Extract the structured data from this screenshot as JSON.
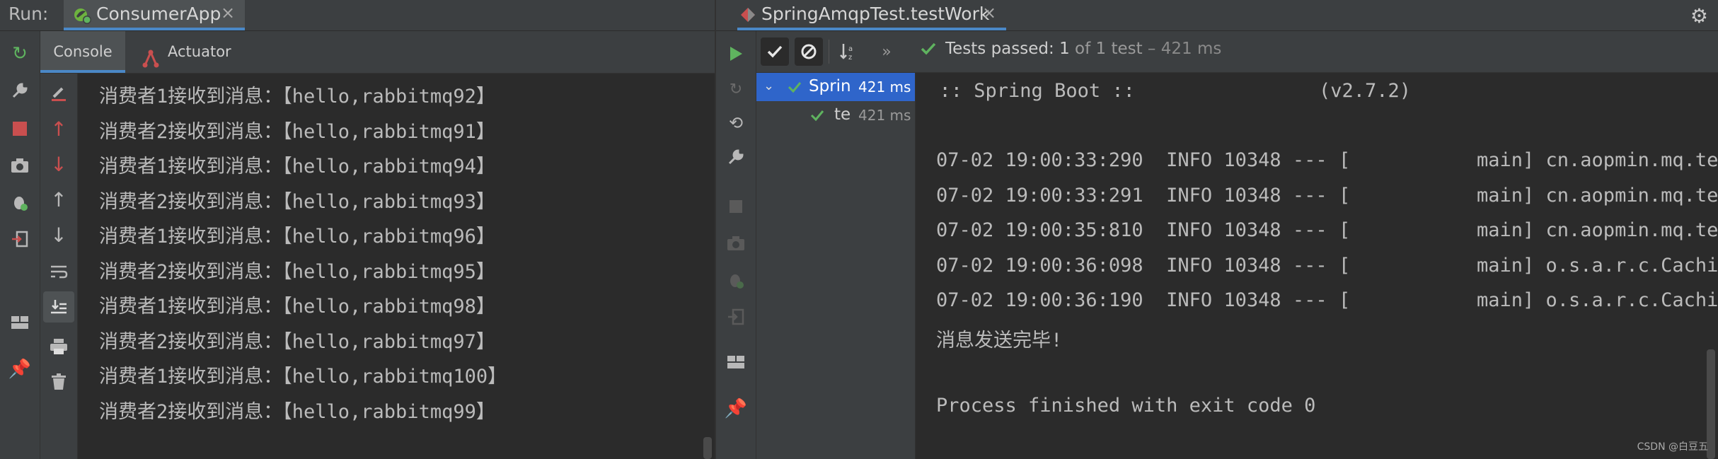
{
  "header": {
    "run_label": "Run:",
    "tab_left": "ConsumerApp",
    "tab_right": "SpringAmqpTest.testWork",
    "close_glyph": "×"
  },
  "left_panel": {
    "subtabs": {
      "console": "Console",
      "actuator": "Actuator"
    },
    "console_lines": [
      "消费者1接收到消息：【hello,rabbitmq92】",
      "消费者2接收到消息：【hello,rabbitmq91】",
      "消费者1接收到消息：【hello,rabbitmq94】",
      "消费者2接收到消息：【hello,rabbitmq93】",
      "消费者1接收到消息：【hello,rabbitmq96】",
      "消费者2接收到消息：【hello,rabbitmq95】",
      "消费者1接收到消息：【hello,rabbitmq98】",
      "消费者2接收到消息：【hello,rabbitmq97】",
      "消费者1接收到消息：【hello,rabbitmq100】",
      "消费者2接收到消息：【hello,rabbitmq99】"
    ]
  },
  "right_panel": {
    "status": {
      "passed": "Tests passed:",
      "count": "1",
      "of": "of 1 test",
      "time": "– 421 ms"
    },
    "tree": [
      {
        "name": "Spring",
        "time": "421 ms"
      },
      {
        "name": "tes",
        "time": "421 ms"
      }
    ],
    "output_lines": [
      "  :: Spring Boot ::                (v2.7.2)",
      "",
      "",
      "07-02 19:00:33:290  INFO 10348 --- [           main] cn.aopmin.mq.test",
      "07-02 19:00:33:291  INFO 10348 --- [           main] cn.aopmin.mq.test",
      "07-02 19:00:35:810  INFO 10348 --- [           main] cn.aopmin.mq.test",
      "07-02 19:00:36:098  INFO 10348 --- [           main] o.s.a.r.c.Cachin",
      "07-02 19:00:36:190  INFO 10348 --- [           main] o.s.a.r.c.Cachin",
      "消息发送完毕!",
      "",
      "Process finished with exit code 0"
    ]
  },
  "watermark": "CSDN @白豆五",
  "colors": {
    "accent": "#4a88c7",
    "pass_green": "#5fb35f",
    "stop_red": "#c94f4f",
    "bg": "#2b2b2b",
    "panel": "#3c3f41"
  }
}
